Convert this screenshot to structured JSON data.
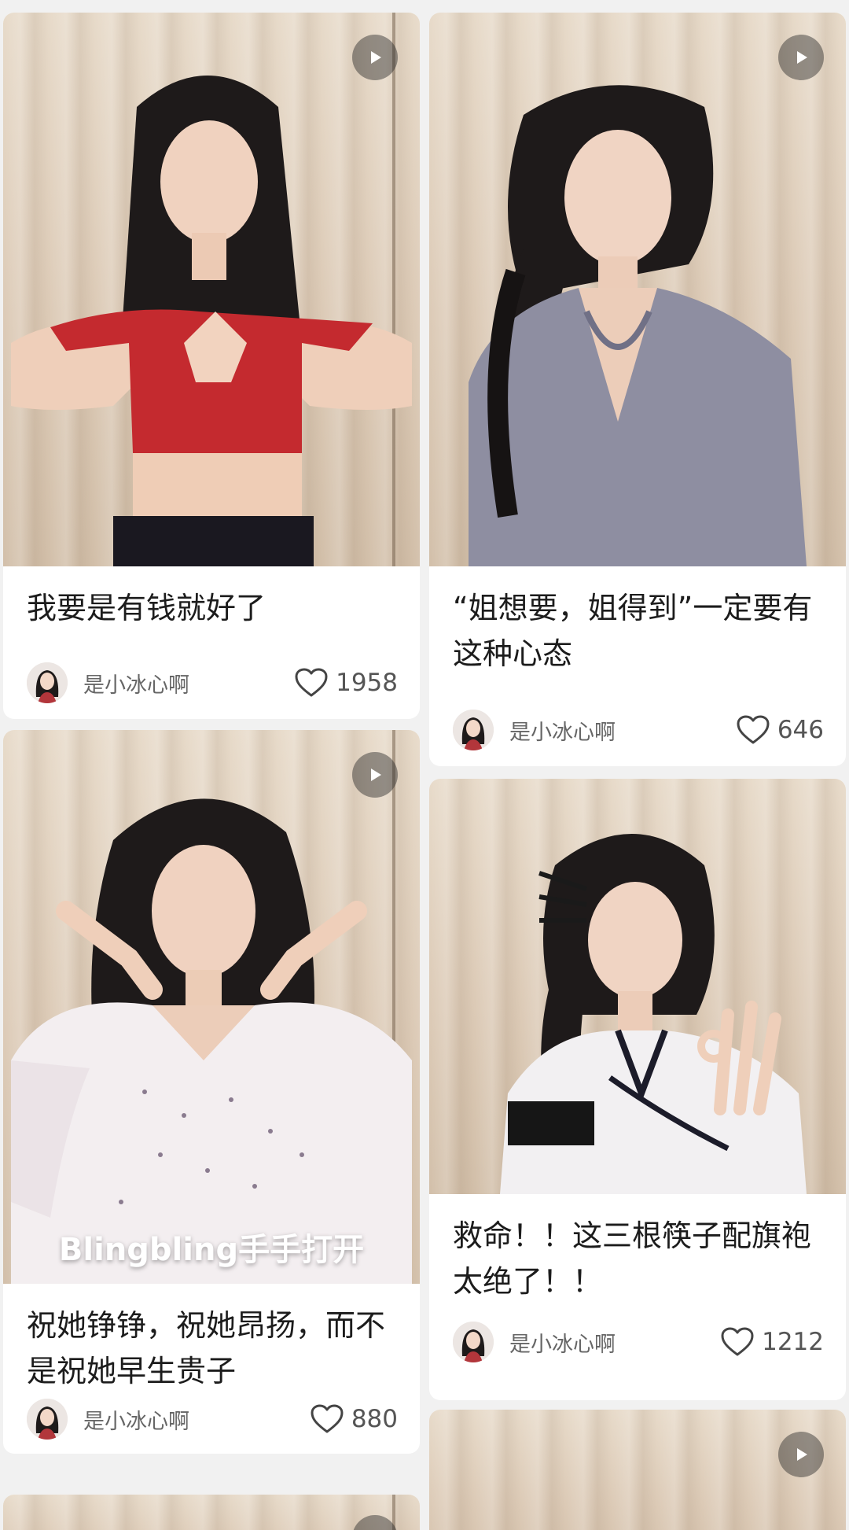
{
  "feed": {
    "posts": [
      {
        "title": "我要是有钱就好了",
        "author": "是小冰心啊",
        "likes": "1958",
        "type": "video"
      },
      {
        "title": "“姐想要，姐得到”一定要有这种心态",
        "author": "是小冰心啊",
        "likes": "646",
        "type": "video"
      },
      {
        "title": "祝她铮铮，祝她昂扬，而不是祝她早生贵子",
        "author": "是小冰心啊",
        "likes": "880",
        "type": "video",
        "overlay_text": "Blingbling手手打开"
      },
      {
        "title": "救命！！这三根筷子配旗袍太绝了！！",
        "author": "是小冰心啊",
        "likes": "1212",
        "type": "video"
      }
    ]
  },
  "icons": {
    "play": "play-icon",
    "heart": "heart-icon",
    "avatar": "author-avatar"
  },
  "colors": {
    "page_background": "#f1f1f1",
    "card_background": "#ffffff",
    "title_text": "#1c1c1c",
    "meta_text": "#666666"
  }
}
